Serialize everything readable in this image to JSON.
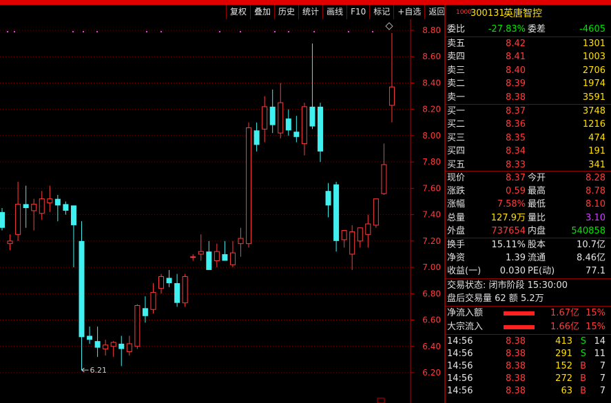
{
  "toolbar": [
    "复权",
    "叠加",
    "历史",
    "统计",
    "画线",
    "F10",
    "标记",
    "+自选",
    "返回"
  ],
  "stock": {
    "badge": "1000",
    "code": "300131",
    "name": "英唐智控"
  },
  "ratio": {
    "label1": "委比",
    "val1": "-27.83%",
    "label2": "委差",
    "val2": "-4605"
  },
  "asks": [
    {
      "label": "卖五",
      "price": "8.42",
      "vol": "1301"
    },
    {
      "label": "卖四",
      "price": "8.41",
      "vol": "1003"
    },
    {
      "label": "卖三",
      "price": "8.40",
      "vol": "2706"
    },
    {
      "label": "卖二",
      "price": "8.39",
      "vol": "1974"
    },
    {
      "label": "卖一",
      "price": "8.38",
      "vol": "3591"
    }
  ],
  "bids": [
    {
      "label": "买一",
      "price": "8.37",
      "vol": "3748"
    },
    {
      "label": "买二",
      "price": "8.36",
      "vol": "1216"
    },
    {
      "label": "买三",
      "price": "8.35",
      "vol": "474"
    },
    {
      "label": "买四",
      "price": "8.34",
      "vol": "191"
    },
    {
      "label": "买五",
      "price": "8.33",
      "vol": "341"
    }
  ],
  "quote": [
    {
      "l1": "现价",
      "v1": "8.37",
      "c1": "red",
      "l2": "今开",
      "v2": "8.28",
      "c2": "red"
    },
    {
      "l1": "涨跌",
      "v1": "0.59",
      "c1": "red",
      "l2": "最高",
      "v2": "8.78",
      "c2": "red"
    },
    {
      "l1": "涨幅",
      "v1": "7.58%",
      "c1": "red",
      "l2": "最低",
      "v2": "8.10",
      "c2": "red"
    },
    {
      "l1": "总量",
      "v1": "127.9万",
      "c1": "yel",
      "l2": "量比",
      "v2": "3.10",
      "c2": "pur"
    },
    {
      "l1": "外盘",
      "v1": "737654",
      "c1": "red",
      "l2": "内盘",
      "v2": "540858",
      "c2": "grn"
    }
  ],
  "stats": [
    {
      "l1": "换手",
      "v1": "15.11%",
      "l2": "股本",
      "v2": "10.7亿"
    },
    {
      "l1": "净资",
      "v1": "1.39",
      "l2": "流通",
      "v2": "8.46亿"
    },
    {
      "l1": "收益(一)",
      "v1": "0.030",
      "l2": "PE(动)",
      "v2": "77.1"
    }
  ],
  "status": {
    "line1": "交易状态: 闭市阶段 15:30:00",
    "line2": "盘后交易量 62 额 5.2万"
  },
  "flows": [
    {
      "label": "净流入额",
      "amount": "1.67亿",
      "pct": "15%",
      "bar": 0.5
    },
    {
      "label": "大宗流入",
      "amount": "1.66亿",
      "pct": "15%",
      "bar": 0.5
    }
  ],
  "ticks": [
    {
      "time": "14:56",
      "price": "8.38",
      "vol": "413",
      "side": "S",
      "n": "14"
    },
    {
      "time": "14:56",
      "price": "8.38",
      "vol": "291",
      "side": "S",
      "n": "11"
    },
    {
      "time": "14:56",
      "price": "8.38",
      "vol": "152",
      "side": "B",
      "n": "7"
    },
    {
      "time": "14:56",
      "price": "8.38",
      "vol": "272",
      "side": "B",
      "n": "7"
    },
    {
      "time": "14:56",
      "price": "8.38",
      "vol": "63",
      "side": "B",
      "n": "7"
    }
  ],
  "chart_data": {
    "type": "candlestick",
    "y_ticks": [
      "8.80",
      "8.60",
      "8.40",
      "8.20",
      "8.00",
      "7.80",
      "7.60",
      "7.40",
      "7.20",
      "7.00",
      "6.80",
      "6.60",
      "6.40",
      "6.20"
    ],
    "ylim": [
      6.1,
      8.88
    ],
    "min_marker": "6.21",
    "up_color": "#ff3c3c",
    "down_color": "#40f0f0",
    "candles": [
      [
        7.42,
        7.45,
        7.28,
        7.3
      ],
      [
        7.18,
        7.25,
        7.13,
        7.2
      ],
      [
        7.25,
        7.65,
        7.2,
        7.48
      ],
      [
        7.48,
        7.62,
        7.3,
        7.45
      ],
      [
        7.43,
        7.52,
        7.28,
        7.48
      ],
      [
        7.41,
        7.58,
        7.36,
        7.52
      ],
      [
        7.49,
        7.62,
        7.42,
        7.52
      ],
      [
        7.52,
        7.55,
        7.35,
        7.47
      ],
      [
        7.48,
        7.5,
        7.4,
        7.43
      ],
      [
        7.47,
        7.32,
        7.0,
        7.32
      ],
      [
        7.2,
        7.35,
        6.22,
        6.47
      ],
      [
        6.48,
        6.55,
        6.42,
        6.45
      ],
      [
        6.44,
        6.55,
        6.32,
        6.39
      ],
      [
        6.38,
        6.45,
        6.33,
        6.41
      ],
      [
        6.4,
        6.44,
        6.32,
        6.43
      ],
      [
        6.42,
        6.48,
        6.25,
        6.38
      ],
      [
        6.36,
        6.48,
        6.33,
        6.42
      ],
      [
        6.4,
        6.72,
        6.38,
        6.71
      ],
      [
        6.69,
        6.78,
        6.58,
        6.63
      ],
      [
        6.68,
        6.88,
        6.65,
        6.81
      ],
      [
        6.84,
        6.95,
        6.8,
        6.93
      ],
      [
        6.92,
        6.98,
        6.85,
        6.88
      ],
      [
        6.88,
        6.95,
        6.7,
        6.73
      ],
      [
        6.73,
        6.95,
        6.7,
        6.93
      ],
      [
        7.08,
        7.1,
        7.05,
        7.08
      ],
      [
        7.1,
        7.25,
        7.05,
        7.12
      ],
      [
        7.12,
        7.2,
        7.0,
        6.98
      ],
      [
        7.05,
        7.18,
        7.0,
        7.12
      ],
      [
        7.1,
        7.2,
        7.05,
        7.05
      ],
      [
        7.02,
        7.2,
        7.0,
        7.11
      ],
      [
        7.18,
        7.3,
        7.08,
        7.22
      ],
      [
        7.18,
        8.1,
        7.15,
        8.06
      ],
      [
        8.04,
        8.1,
        7.88,
        7.93
      ],
      [
        8.05,
        8.3,
        7.95,
        8.22
      ],
      [
        8.22,
        8.35,
        8.02,
        8.08
      ],
      [
        8.02,
        8.4,
        7.98,
        8.25
      ],
      [
        8.13,
        8.2,
        8.0,
        8.04
      ],
      [
        8.03,
        8.15,
        7.95,
        7.99
      ],
      [
        7.94,
        8.25,
        7.85,
        8.22
      ],
      [
        8.22,
        8.7,
        8.05,
        8.07
      ],
      [
        8.22,
        8.25,
        7.8,
        7.88
      ],
      [
        7.58,
        7.64,
        7.38,
        7.47
      ],
      [
        7.63,
        7.65,
        7.12,
        7.2
      ],
      [
        7.21,
        7.25,
        7.15,
        7.28
      ],
      [
        7.1,
        7.32,
        6.98,
        7.27
      ],
      [
        7.2,
        7.3,
        7.15,
        7.3
      ],
      [
        7.25,
        7.4,
        7.15,
        7.33
      ],
      [
        7.32,
        7.52,
        7.3,
        7.52
      ],
      [
        7.56,
        7.94,
        7.55,
        7.78
      ],
      [
        8.23,
        8.78,
        8.1,
        8.37
      ]
    ]
  }
}
